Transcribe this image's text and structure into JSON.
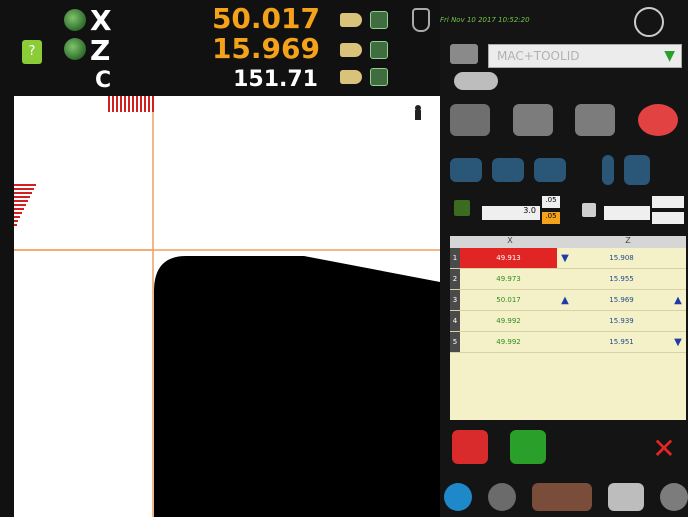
{
  "readouts": {
    "x": {
      "axis": "X",
      "value": "50.017"
    },
    "z": {
      "axis": "Z",
      "value": "15.969"
    },
    "c": {
      "axis": "C",
      "value": "151.71"
    }
  },
  "status": {
    "datetime": "Fri Nov 10 2017 10:52:20",
    "machine_select": "MAC+TOOLID"
  },
  "offsets": {
    "left_main": "3.0",
    "left_top": ".05",
    "left_bottom": ".05"
  },
  "table": {
    "headers": [
      "X",
      "Z"
    ],
    "rows": [
      {
        "n": "1",
        "x": "49.913",
        "z": "15.908"
      },
      {
        "n": "2",
        "x": "49.973",
        "z": "15.955"
      },
      {
        "n": "3",
        "x": "50.017",
        "z": "15.969"
      },
      {
        "n": "4",
        "x": "49.992",
        "z": "15.939"
      },
      {
        "n": "5",
        "x": "49.992",
        "z": "15.951"
      }
    ]
  },
  "colors": {
    "accent": "#f3a21a",
    "readout_white": "#ffffff",
    "panel_bg": "#141414",
    "table_bg": "#f4f0c8",
    "selected_row": "#e12525",
    "green_text": "#2f8d22",
    "red_button": "#d92b2b",
    "green_button": "#2aa02a"
  },
  "icons": {
    "help": "help-book-icon",
    "globe": "globe-icon",
    "jog": "jog-hand-icon",
    "settings": "gear-cube-icon",
    "camera": "camera-icon",
    "close": "close-x-icon"
  }
}
